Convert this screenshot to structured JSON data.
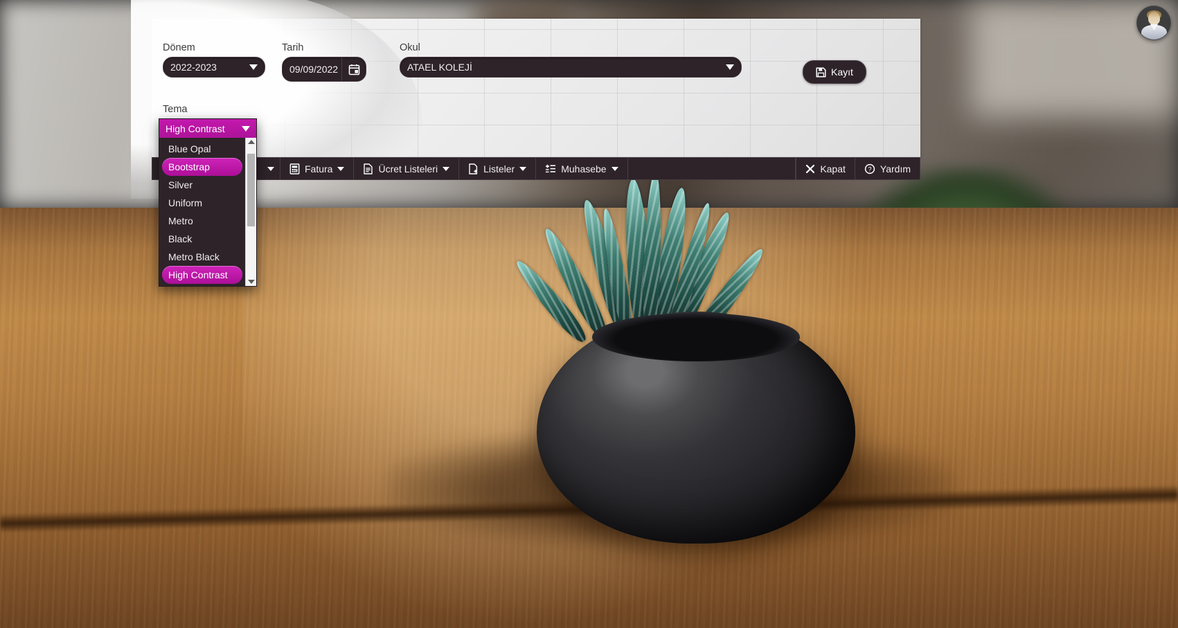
{
  "window": {
    "fields": {
      "donem": {
        "label": "Dönem",
        "value": "2022-2023"
      },
      "tarih": {
        "label": "Tarih",
        "value": "09/09/2022",
        "icon": "calendar-icon"
      },
      "okul": {
        "label": "Okul",
        "value": "ATAEL KOLEJİ"
      },
      "tema": {
        "label": "Tema",
        "value": "High Contrast"
      }
    },
    "save_button": {
      "label": "Kayıt",
      "icon": "save-floppy-icon"
    }
  },
  "theme_dropdown": {
    "selected": "High Contrast",
    "hovered": "Bootstrap",
    "options": [
      "Blue Opal",
      "Bootstrap",
      "Silver",
      "Uniform",
      "Metro",
      "Black",
      "Metro Black",
      "High Contrast"
    ],
    "accent_color": "#c318ad"
  },
  "toolbar": {
    "settings_icon": "gear-icon",
    "items": [
      {
        "label": "Fatura",
        "icon": "invoice-icon",
        "has_caret": true
      },
      {
        "label": "Ücret Listeleri",
        "icon": "document-list-icon",
        "has_caret": true
      },
      {
        "label": "Listeler",
        "icon": "document-add-icon",
        "has_caret": true
      },
      {
        "label": "Muhasebe",
        "icon": "ledger-icon",
        "has_caret": true
      }
    ],
    "right_items": [
      {
        "label": "Kapat",
        "icon": "close-x-icon"
      },
      {
        "label": "Yardım",
        "icon": "question-circle-icon"
      }
    ],
    "background_color": "#2d2329"
  },
  "avatar": {
    "name": "user-avatar"
  }
}
